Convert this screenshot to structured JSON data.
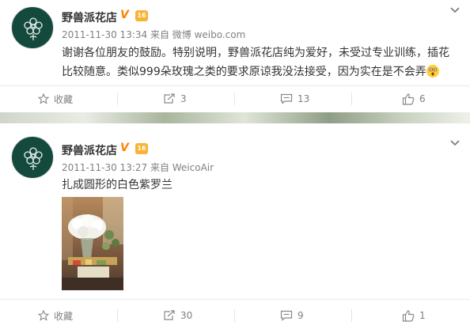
{
  "posts": [
    {
      "user": {
        "name": "野兽派花店",
        "verified_badge": "V",
        "level_badge": "16"
      },
      "meta": "2011-11-30 13:34 来自 微博 weibo.com",
      "text_line1": "谢谢各位朋友的鼓励。特别说明，野兽派花店纯为爱好，未受过专业训练，插花",
      "text_line2": "比较随意。类似999朵玫瑰之类的要求原谅我没法接受，因为实在是不会弄",
      "emoji": "surprised-face-icon",
      "actions": {
        "favorite_label": "收藏",
        "repost_count": "3",
        "comment_count": "13",
        "like_count": "6"
      }
    },
    {
      "user": {
        "name": "野兽派花店",
        "verified_badge": "V",
        "level_badge": "16"
      },
      "meta": "2011-11-30 13:27 来自 WeicoAir",
      "text_line1": "扎成圆形的白色紫罗兰",
      "image": "white-violet-bouquet-photo",
      "actions": {
        "favorite_label": "收藏",
        "repost_count": "30",
        "comment_count": "9",
        "like_count": "1"
      }
    }
  ],
  "colors": {
    "badge": "#ff8200",
    "meta": "#808080",
    "avatar": "#144a3e"
  }
}
